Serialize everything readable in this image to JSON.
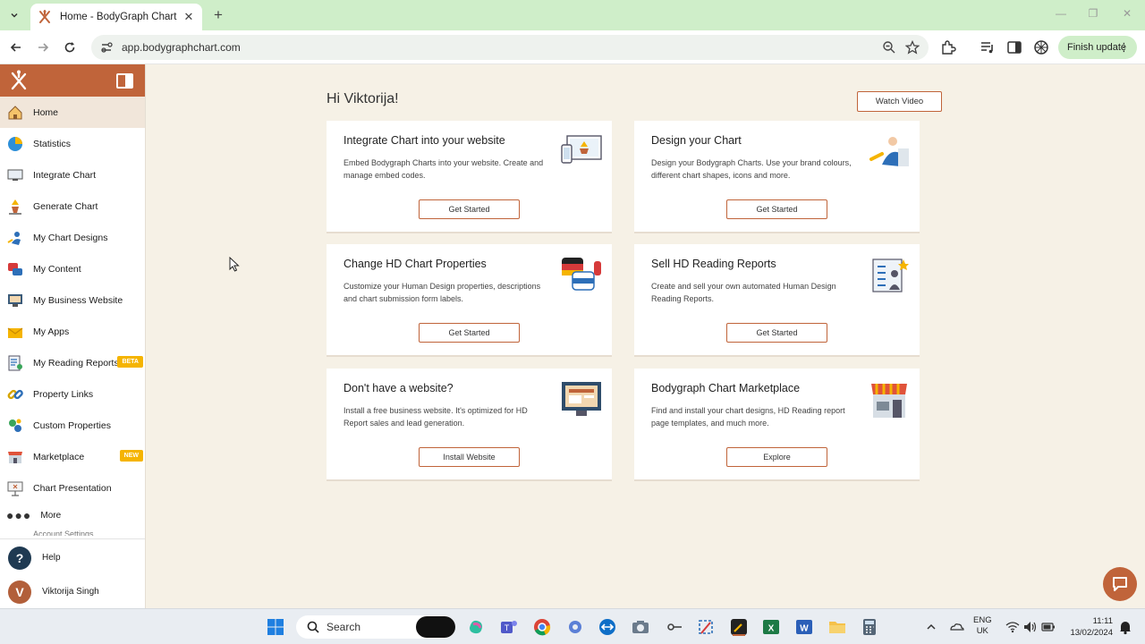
{
  "browser": {
    "tab_title": "Home - BodyGraph Chart",
    "url": "app.bodygraphchart.com",
    "finish_update": "Finish update",
    "new_tab_symbol": "+",
    "close_tab_symbol": "✕",
    "minimize_symbol": "—",
    "maximize_symbol": "❐",
    "close_window_symbol": "✕"
  },
  "colors": {
    "brand": "#c0643a",
    "badge": "#f5b400",
    "background": "#f6f1e6",
    "tab_strip": "#cfeec9"
  },
  "sidebar": {
    "items": [
      {
        "label": "Home",
        "icon": "home-icon",
        "active": true
      },
      {
        "label": "Statistics",
        "icon": "pie-chart-icon"
      },
      {
        "label": "Integrate Chart",
        "icon": "monitor-icon"
      },
      {
        "label": "Generate Chart",
        "icon": "bodygraph-icon"
      },
      {
        "label": "My Chart Designs",
        "icon": "designer-icon"
      },
      {
        "label": "My Content",
        "icon": "content-icon"
      },
      {
        "label": "My Business Website",
        "icon": "website-icon"
      },
      {
        "label": "My Apps",
        "icon": "apps-icon"
      },
      {
        "label": "My Reading Reports",
        "icon": "report-icon",
        "badge": "BETA"
      },
      {
        "label": "Property Links",
        "icon": "link-icon"
      },
      {
        "label": "Custom Properties",
        "icon": "properties-icon"
      },
      {
        "label": "Marketplace",
        "icon": "store-icon",
        "badge": "NEW"
      },
      {
        "label": "Chart Presentation",
        "icon": "presentation-icon"
      }
    ],
    "more_label": "More",
    "account_settings": "Account Settings",
    "help_label": "Help",
    "help_initial": "?",
    "user_name": "Viktorija Singh",
    "user_initial": "V"
  },
  "main": {
    "greeting": "Hi Viktorija!",
    "watch_video": "Watch Video",
    "cards": [
      {
        "title": "Integrate Chart into your website",
        "desc": "Embed Bodygraph Charts into your website. Create and manage embed codes.",
        "button": "Get Started",
        "icon": "embed-illustration-icon"
      },
      {
        "title": "Design your Chart",
        "desc": "Design your Bodygraph Charts. Use your brand colours, different chart shapes, icons and more.",
        "button": "Get Started",
        "icon": "design-illustration-icon"
      },
      {
        "title": "Change HD Chart Properties",
        "desc": "Customize your Human Design properties, descriptions and chart submission form labels.",
        "button": "Get Started",
        "icon": "speech-flags-icon"
      },
      {
        "title": "Sell HD Reading Reports",
        "desc": "Create and sell your own automated Human Design Reading Reports.",
        "button": "Get Started",
        "icon": "report-illustration-icon"
      },
      {
        "title": "Don't have a website?",
        "desc": "Install a free business website. It's optimized for HD Report sales and lead generation.",
        "button": "Install Website",
        "icon": "monitor-illustration-icon"
      },
      {
        "title": "Bodygraph Chart Marketplace",
        "desc": "Find and install your chart designs, HD Reading report page templates, and much more.",
        "button": "Explore",
        "icon": "shop-illustration-icon"
      }
    ]
  },
  "taskbar": {
    "search_label": "Search",
    "lang_line1": "ENG",
    "lang_line2": "UK",
    "time": "11:11",
    "date": "13/02/2024"
  }
}
